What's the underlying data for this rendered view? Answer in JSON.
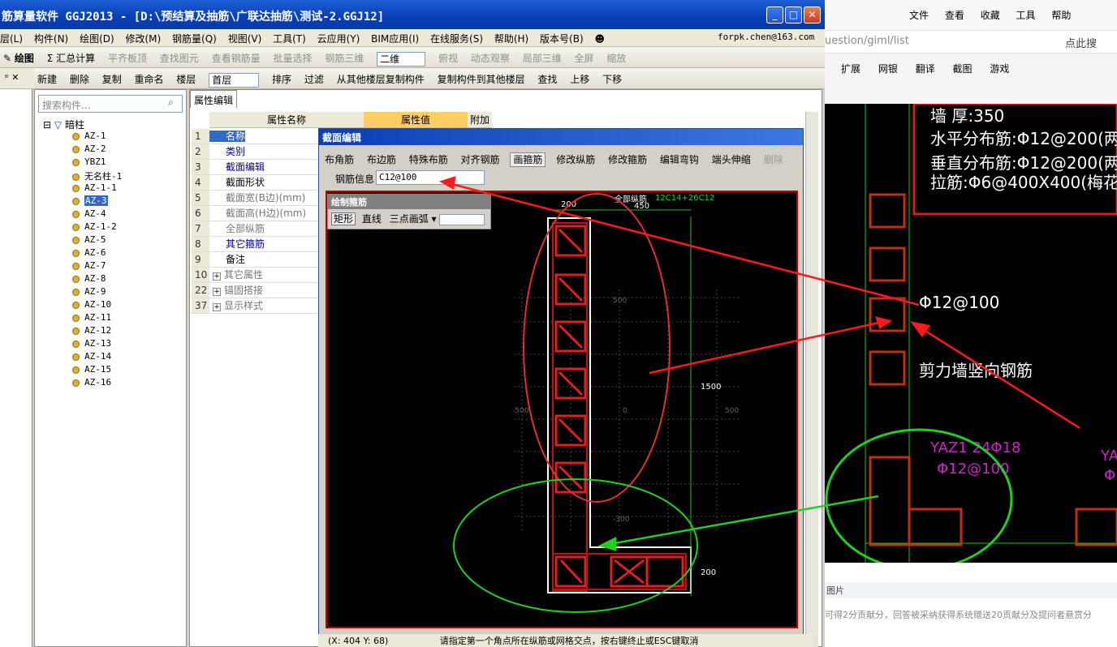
{
  "window": {
    "title": "筋算量软件 GGJ2013 - [D:\\预结算及抽筋\\广联达抽筋\\测试-2.GGJ12]"
  },
  "menu": [
    "层(L)",
    "构件(N)",
    "绘图(D)",
    "修改(M)",
    "钢筋量(Q)",
    "视图(V)",
    "工具(T)",
    "云应用(Y)",
    "BIM应用(I)",
    "在线服务(S)",
    "帮助(H)",
    "版本号(B)"
  ],
  "user": "forpk.chen@163.com",
  "toolbar1": {
    "draw": "绘图",
    "summary": "Σ 汇总计算",
    "flat": "平齐板顶",
    "find": "查找图元",
    "view_rebar": "查看钢筋量",
    "batch": "批量选择",
    "rebar3d": "钢筋三维",
    "mode": "二维",
    "top_view": "俯视",
    "dyn": "动态观察",
    "local3d": "局部三维",
    "full": "全屏",
    "zoom": "缩放"
  },
  "toolbar2": {
    "new": "新建",
    "delete": "删除",
    "copy": "复制",
    "rename": "重命名",
    "floor_label": "楼层",
    "floor": "首层",
    "sort": "排序",
    "filter": "过滤",
    "copy_from": "从其他楼层复制构件",
    "copy_to": "复制构件到其他楼层",
    "find": "查找",
    "up": "上移",
    "down": "下移"
  },
  "tree": {
    "search_placeholder": "搜索构件...",
    "root": "暗柱",
    "items": [
      "AZ-1",
      "AZ-2",
      "YBZ1",
      "无名柱-1",
      "AZ-1-1",
      "AZ-3",
      "AZ-4",
      "AZ-1-2",
      "AZ-5",
      "AZ-6",
      "AZ-7",
      "AZ-8",
      "AZ-9",
      "AZ-10",
      "AZ-11",
      "AZ-12",
      "AZ-13",
      "AZ-14",
      "AZ-15",
      "AZ-16"
    ]
  },
  "props": {
    "tab": "属性编辑",
    "col_name": "属性名称",
    "col_value": "属性值",
    "col_extra": "附加",
    "rows": [
      {
        "n": "1",
        "t": "名称"
      },
      {
        "n": "2",
        "t": "类别"
      },
      {
        "n": "3",
        "t": "截面编辑"
      },
      {
        "n": "4",
        "t": "截面形状"
      },
      {
        "n": "5",
        "t": "截面宽(B边)(mm)"
      },
      {
        "n": "6",
        "t": "截面高(H边)(mm)"
      },
      {
        "n": "7",
        "t": "全部纵筋"
      },
      {
        "n": "8",
        "t": "其它箍筋"
      },
      {
        "n": "9",
        "t": "备注"
      },
      {
        "n": "10",
        "t": "其它属性"
      },
      {
        "n": "22",
        "t": "锚固搭接"
      },
      {
        "n": "37",
        "t": "显示样式"
      }
    ]
  },
  "dialog": {
    "title": "截面编辑",
    "tools": [
      "布角筋",
      "布边筋",
      "特殊布筋",
      "对齐钢筋",
      "画箍筋",
      "修改纵筋",
      "修改箍筋",
      "编辑弯钩",
      "端头伸缩",
      "删除"
    ],
    "rebar_label": "钢筋信息",
    "rebar_value": "C12@100",
    "draw_title": "绘制箍筋",
    "draw_tools": [
      "矩形",
      "直线",
      "三点画弧"
    ],
    "dims": {
      "top": "200",
      "all_label": "全部纵筋",
      "all_value": "12C14+26C12",
      "w450": "450",
      "h1500": "1500",
      "b200": "200",
      "grid500": "500",
      "gridm500": "-500",
      "grid0": "0",
      "gridm300": "-300"
    },
    "status": "(X: 404 Y: 68)",
    "hint": "请指定第一个角点所在纵筋或网格交点，按右键终止或ESC键取消"
  },
  "browser": {
    "menu": [
      "文件",
      "查看",
      "收藏",
      "工具",
      "帮助"
    ],
    "url": "uestion/giml/list",
    "search": "点此搜",
    "fav": [
      "扩展",
      "网银",
      "翻译",
      "截图",
      "游戏"
    ]
  },
  "cad": {
    "wall": "墙 厚:350",
    "h": "水平分布筋:Φ12@200(两排",
    "v": "垂直分布筋:Φ12@200(两排",
    "tie": "拉筋:Φ6@400X400(梅花",
    "stir": "Φ12@100",
    "shear": "剪力墙竖向钢筋",
    "yaz": "YAZ1 24Φ18",
    "yaz2": "Φ12@100",
    "ya": "YA",
    "phi": "Φ"
  },
  "rb": {
    "pic": "图片",
    "txt": "可得2分贡献分，回答被采纳获得系统赠送20贡献分及提问者悬赏分"
  }
}
